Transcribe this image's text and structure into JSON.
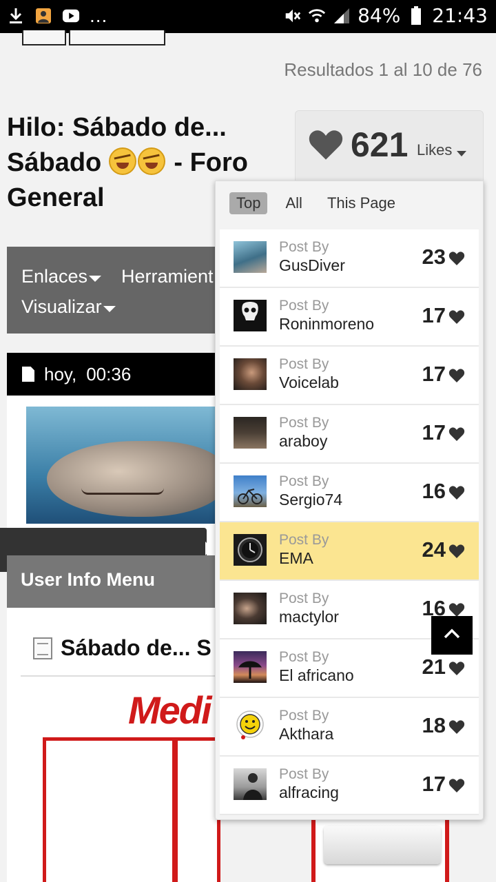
{
  "status_bar": {
    "battery": "84%",
    "time": "21:43",
    "more": "...",
    "icons": [
      "download-icon",
      "image-icon",
      "youtube-icon",
      "mute-icon",
      "wifi-icon",
      "signal-icon",
      "battery-icon"
    ]
  },
  "header": {
    "results": "Resultados 1 al 10 de 76",
    "thread_title_1": "Hilo: Sábado de... Sábado",
    "thread_title_2": "- Foro General"
  },
  "likes": {
    "count": "621",
    "label": "Likes",
    "tabs": [
      "Top",
      "All",
      "This Page"
    ],
    "active_tab": "Top",
    "list": [
      {
        "by": "Post By",
        "user": "GusDiver",
        "count": "23"
      },
      {
        "by": "Post By",
        "user": "Roninmoreno",
        "count": "17"
      },
      {
        "by": "Post By",
        "user": "Voicelab",
        "count": "17"
      },
      {
        "by": "Post By",
        "user": "araboy",
        "count": "17"
      },
      {
        "by": "Post By",
        "user": "Sergio74",
        "count": "16"
      },
      {
        "by": "Post By",
        "user": "EMA",
        "count": "24",
        "highlighted": true
      },
      {
        "by": "Post By",
        "user": "mactylor",
        "count": "16"
      },
      {
        "by": "Post By",
        "user": "El africano",
        "count": "21"
      },
      {
        "by": "Post By",
        "user": "Akthara",
        "count": "18"
      },
      {
        "by": "Post By",
        "user": "alfracing",
        "count": "17"
      }
    ]
  },
  "nav": {
    "enlaces": "Enlaces",
    "herramientas": "Herramient",
    "visualizar": "Visualizar"
  },
  "post": {
    "day": "hoy,",
    "time": "00:36",
    "user_info_menu": "User Info Menu",
    "title": "Sábado de... S",
    "brand": "Medi"
  },
  "colors": {
    "highlight": "#fbe591",
    "nav_bg": "#666666",
    "brand_red": "#d01a1a"
  }
}
